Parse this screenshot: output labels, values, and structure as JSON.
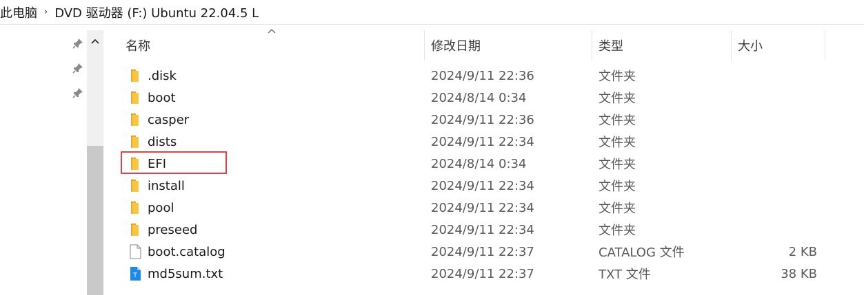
{
  "breadcrumb": {
    "items": [
      "此电脑",
      "DVD 驱动器 (F:) Ubuntu 22.04.5 L"
    ],
    "separator": "›"
  },
  "columns": {
    "name": "名称",
    "date": "修改日期",
    "type": "类型",
    "size": "大小"
  },
  "files": [
    {
      "name": ".disk",
      "date": "2024/9/11 22:36",
      "type": "文件夹",
      "size": "",
      "icon": "folder-icon"
    },
    {
      "name": "boot",
      "date": "2024/8/14 0:34",
      "type": "文件夹",
      "size": "",
      "icon": "folder-icon"
    },
    {
      "name": "casper",
      "date": "2024/9/11 22:36",
      "type": "文件夹",
      "size": "",
      "icon": "folder-icon"
    },
    {
      "name": "dists",
      "date": "2024/9/11 22:34",
      "type": "文件夹",
      "size": "",
      "icon": "folder-icon"
    },
    {
      "name": "EFI",
      "date": "2024/8/14 0:34",
      "type": "文件夹",
      "size": "",
      "icon": "folder-icon",
      "highlighted": true
    },
    {
      "name": "install",
      "date": "2024/9/11 22:34",
      "type": "文件夹",
      "size": "",
      "icon": "folder-icon"
    },
    {
      "name": "pool",
      "date": "2024/9/11 22:34",
      "type": "文件夹",
      "size": "",
      "icon": "folder-icon"
    },
    {
      "name": "preseed",
      "date": "2024/9/11 22:34",
      "type": "文件夹",
      "size": "",
      "icon": "folder-icon"
    },
    {
      "name": "boot.catalog",
      "date": "2024/9/11 22:37",
      "type": "CATALOG 文件",
      "size": "2 KB",
      "icon": "blank-file-icon"
    },
    {
      "name": "md5sum.txt",
      "date": "2024/9/11 22:37",
      "type": "TXT 文件",
      "size": "38 KB",
      "icon": "text-file-icon"
    }
  ],
  "colors": {
    "folder": "#f8c544",
    "folder_dark": "#e8a92a",
    "highlight": "#e0404a",
    "text_file": "#1e88e5"
  }
}
